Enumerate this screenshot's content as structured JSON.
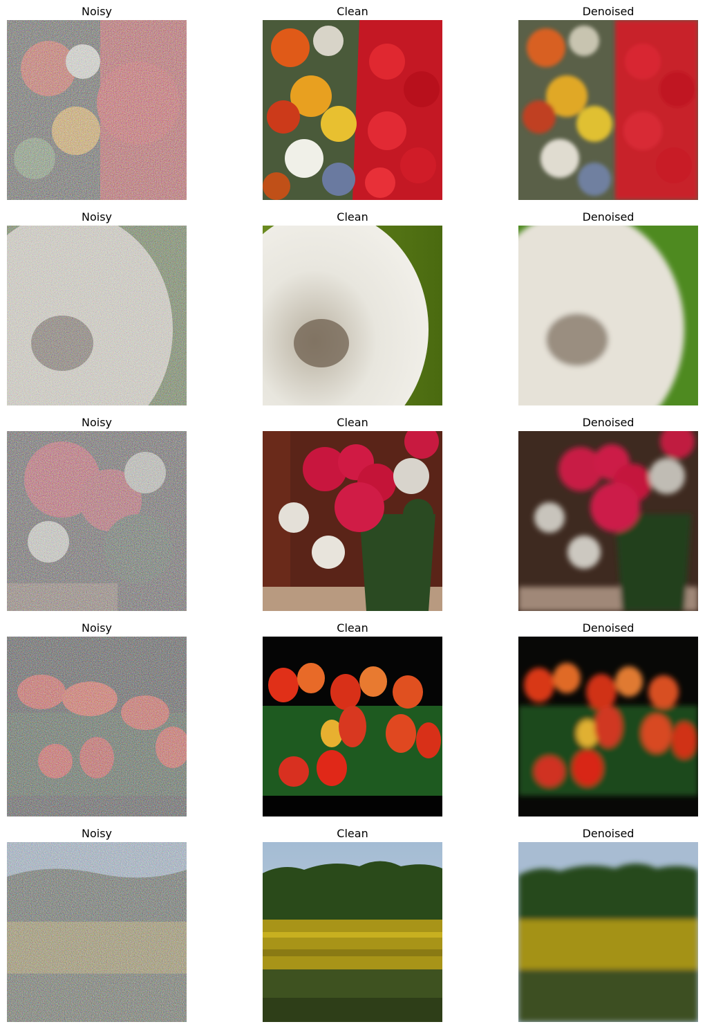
{
  "labels": {
    "noisy": "Noisy",
    "clean": "Clean",
    "denoised": "Denoised"
  },
  "rows": [
    {
      "subject": "flowers-market",
      "noisy_title": "Noisy",
      "clean_title": "Clean",
      "denoised_title": "Denoised"
    },
    {
      "subject": "dandelion",
      "noisy_title": "Noisy",
      "clean_title": "Clean",
      "denoised_title": "Denoised"
    },
    {
      "subject": "roses-bouquet",
      "noisy_title": "Noisy",
      "clean_title": "Clean",
      "denoised_title": "Denoised"
    },
    {
      "subject": "tulips",
      "noisy_title": "Noisy",
      "clean_title": "Clean",
      "denoised_title": "Denoised"
    },
    {
      "subject": "sunflower-field",
      "noisy_title": "Noisy",
      "clean_title": "Clean",
      "denoised_title": "Denoised"
    }
  ],
  "colors": {
    "background": "#ffffff",
    "title_text": "#000000"
  }
}
